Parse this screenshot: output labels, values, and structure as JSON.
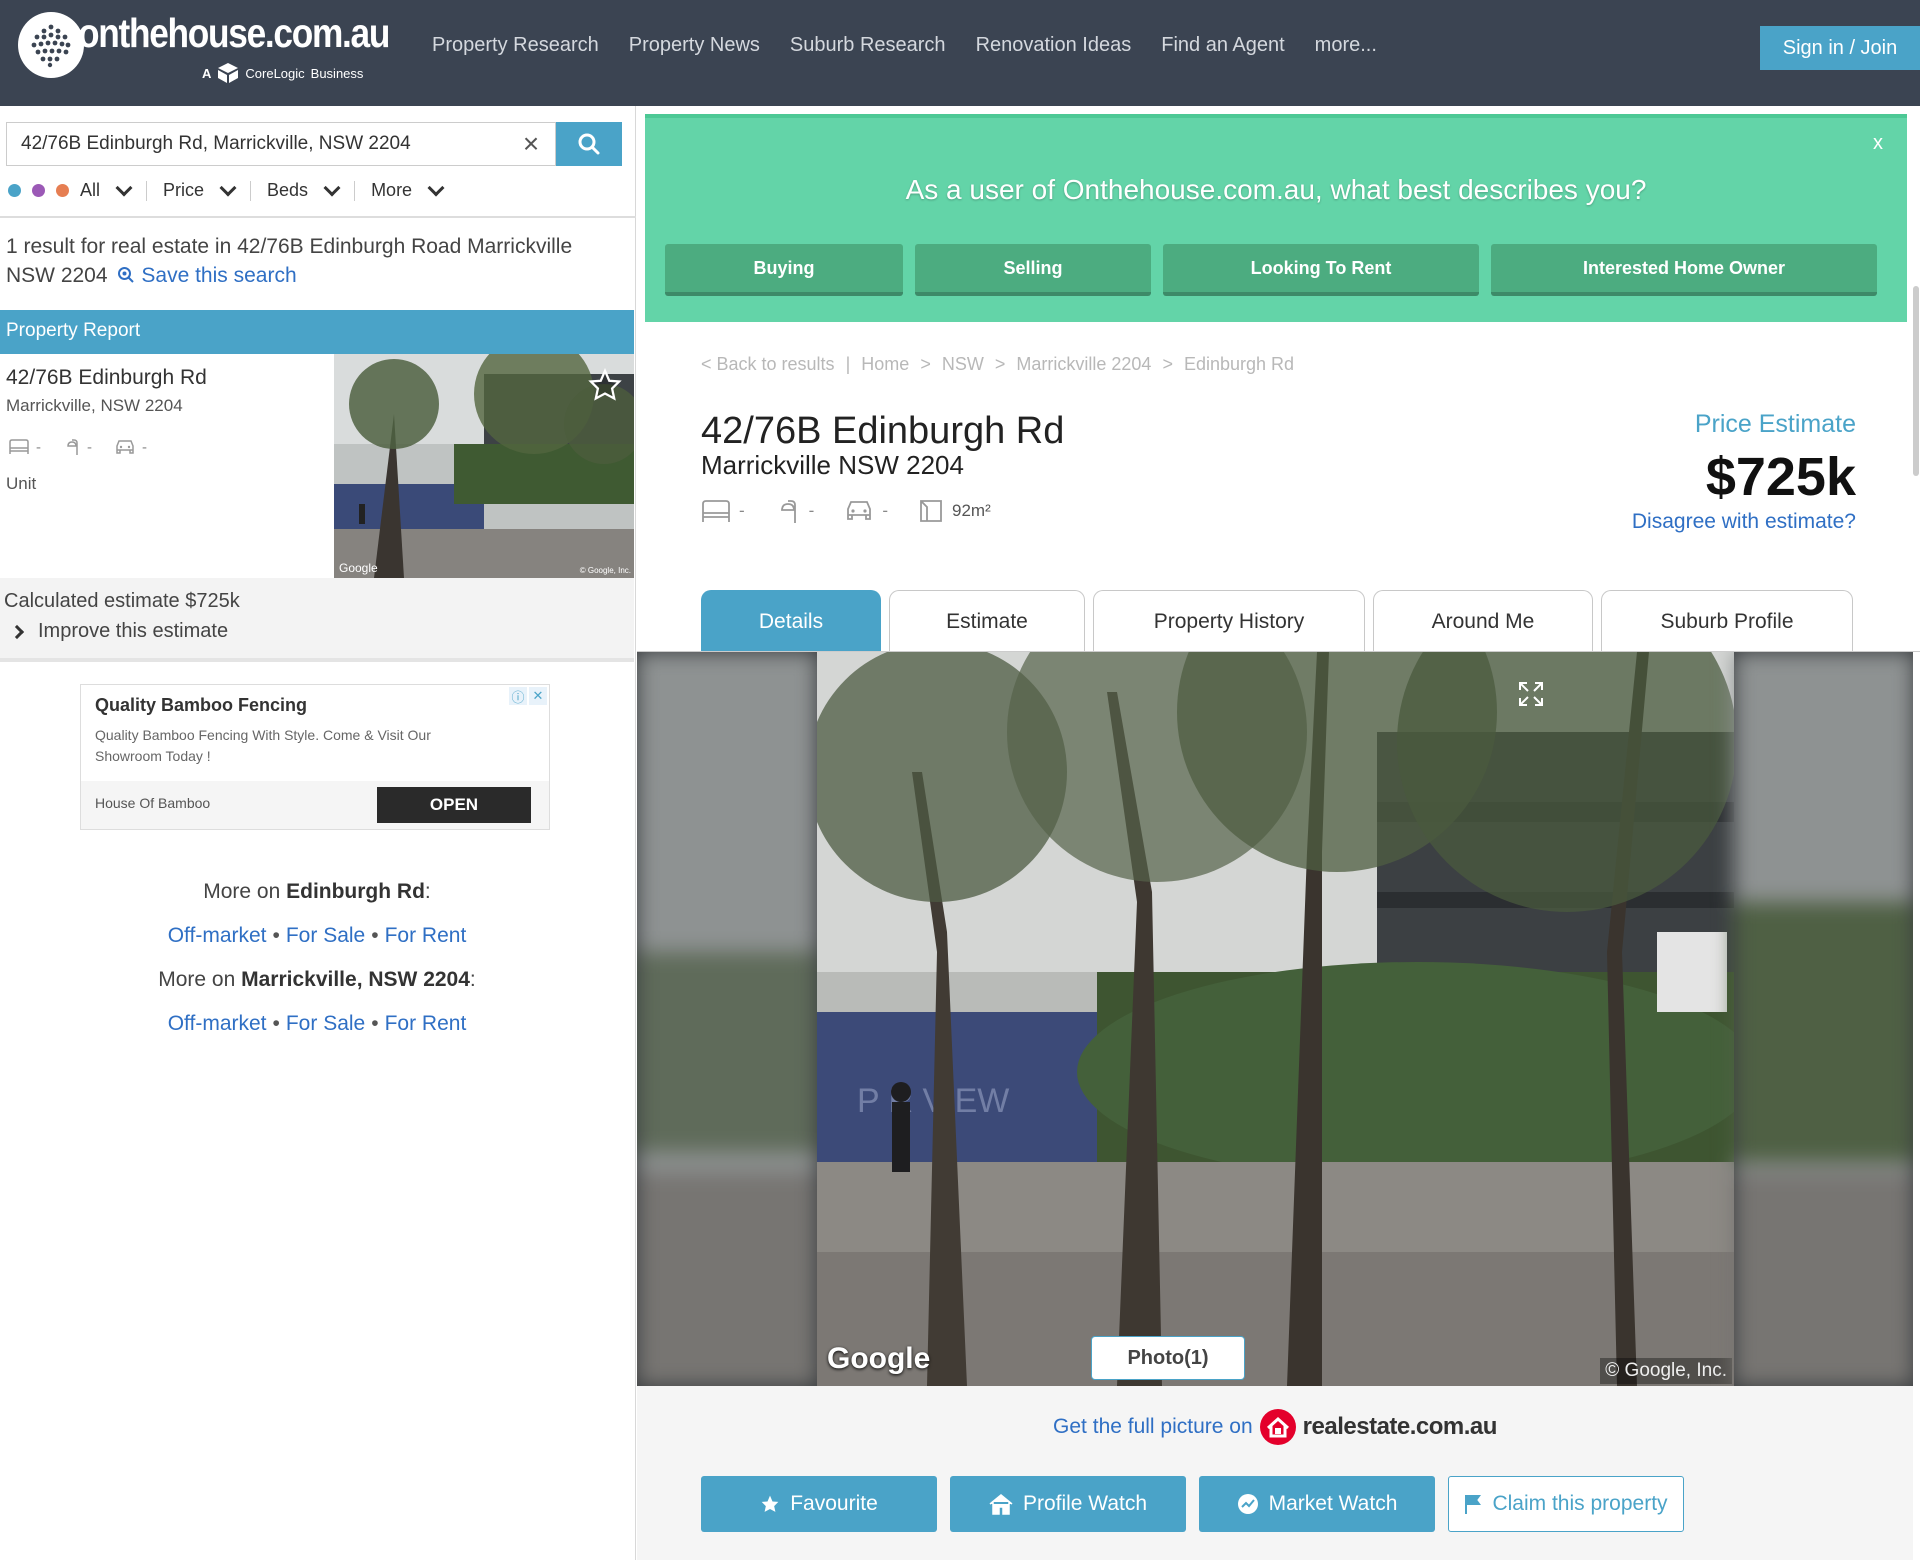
{
  "header": {
    "logo_text": "onthehouse.com.au",
    "logo_sub_prefix": "A",
    "logo_sub_brand": "CoreLogic",
    "logo_sub_suffix": "Business",
    "nav": [
      "Property Research",
      "Property News",
      "Suburb Research",
      "Renovation Ideas",
      "Find an Agent",
      "more..."
    ],
    "signin_label": "Sign in / Join"
  },
  "search": {
    "value": "42/76B Edinburgh Rd, Marrickville, NSW 2204",
    "filters": {
      "all_label": "All",
      "price_label": "Price",
      "beds_label": "Beds",
      "more_label": "More"
    },
    "dot_colors": [
      "#4aa3c8",
      "#9b59b6",
      "#e67e52"
    ]
  },
  "results": {
    "summary": "1 result for real estate in 42/76B Edinburgh Road Marrickville NSW 2204",
    "save_label": "Save this search",
    "report_label": "Property Report",
    "card": {
      "address": "42/76B Edinburgh Rd",
      "suburb": "Marrickville, NSW 2204",
      "beds": "-",
      "baths": "-",
      "cars": "-",
      "type": "Unit",
      "img_google": "Google",
      "img_copy": "© Google, Inc."
    },
    "calculated_estimate": "Calculated estimate $725k",
    "improve_label": "Improve this estimate"
  },
  "ad": {
    "title": "Quality Bamboo Fencing",
    "description": "Quality Bamboo Fencing With Style. Come & Visit Our Showroom Today !",
    "source": "House Of Bamboo",
    "cta": "OPEN"
  },
  "more_on": {
    "street_prefix": "More on",
    "street": "Edinburgh Rd",
    "suburb_prefix": "More on",
    "suburb": "Marrickville, NSW 2204",
    "links": [
      "Off-market",
      "For Sale",
      "For Rent"
    ]
  },
  "survey": {
    "question": "As a user of Onthehouse.com.au, what best describes you?",
    "close": "x",
    "options": [
      "Buying",
      "Selling",
      "Looking To Rent",
      "Interested Home Owner"
    ]
  },
  "breadcrumb": {
    "back": "< Back to results",
    "items": [
      "Home",
      "NSW",
      "Marrickville 2204",
      "Edinburgh Rd"
    ]
  },
  "property": {
    "title": "42/76B Edinburgh Rd",
    "suburb": "Marrickville NSW 2204",
    "beds": "-",
    "baths": "-",
    "cars": "-",
    "area": "92m²",
    "price_label": "Price Estimate",
    "price_value": "$725k",
    "disagree_label": "Disagree with estimate?"
  },
  "tabs": [
    "Details",
    "Estimate",
    "Property History",
    "Around Me",
    "Suburb Profile"
  ],
  "photo": {
    "google": "Google",
    "copyright": "© Google, Inc.",
    "count_label": "Photo(1)"
  },
  "rea": {
    "prefix": "Get the full picture on",
    "brand": "realestate.com.au"
  },
  "actions": {
    "favourite": "Favourite",
    "profile_watch": "Profile Watch",
    "market_watch": "Market Watch",
    "claim": "Claim this property"
  },
  "colors": {
    "header_bg": "#3b4452",
    "accent_blue": "#4aa3c8",
    "survey_green": "#63d4a8",
    "link_blue": "#2f6fc4"
  }
}
